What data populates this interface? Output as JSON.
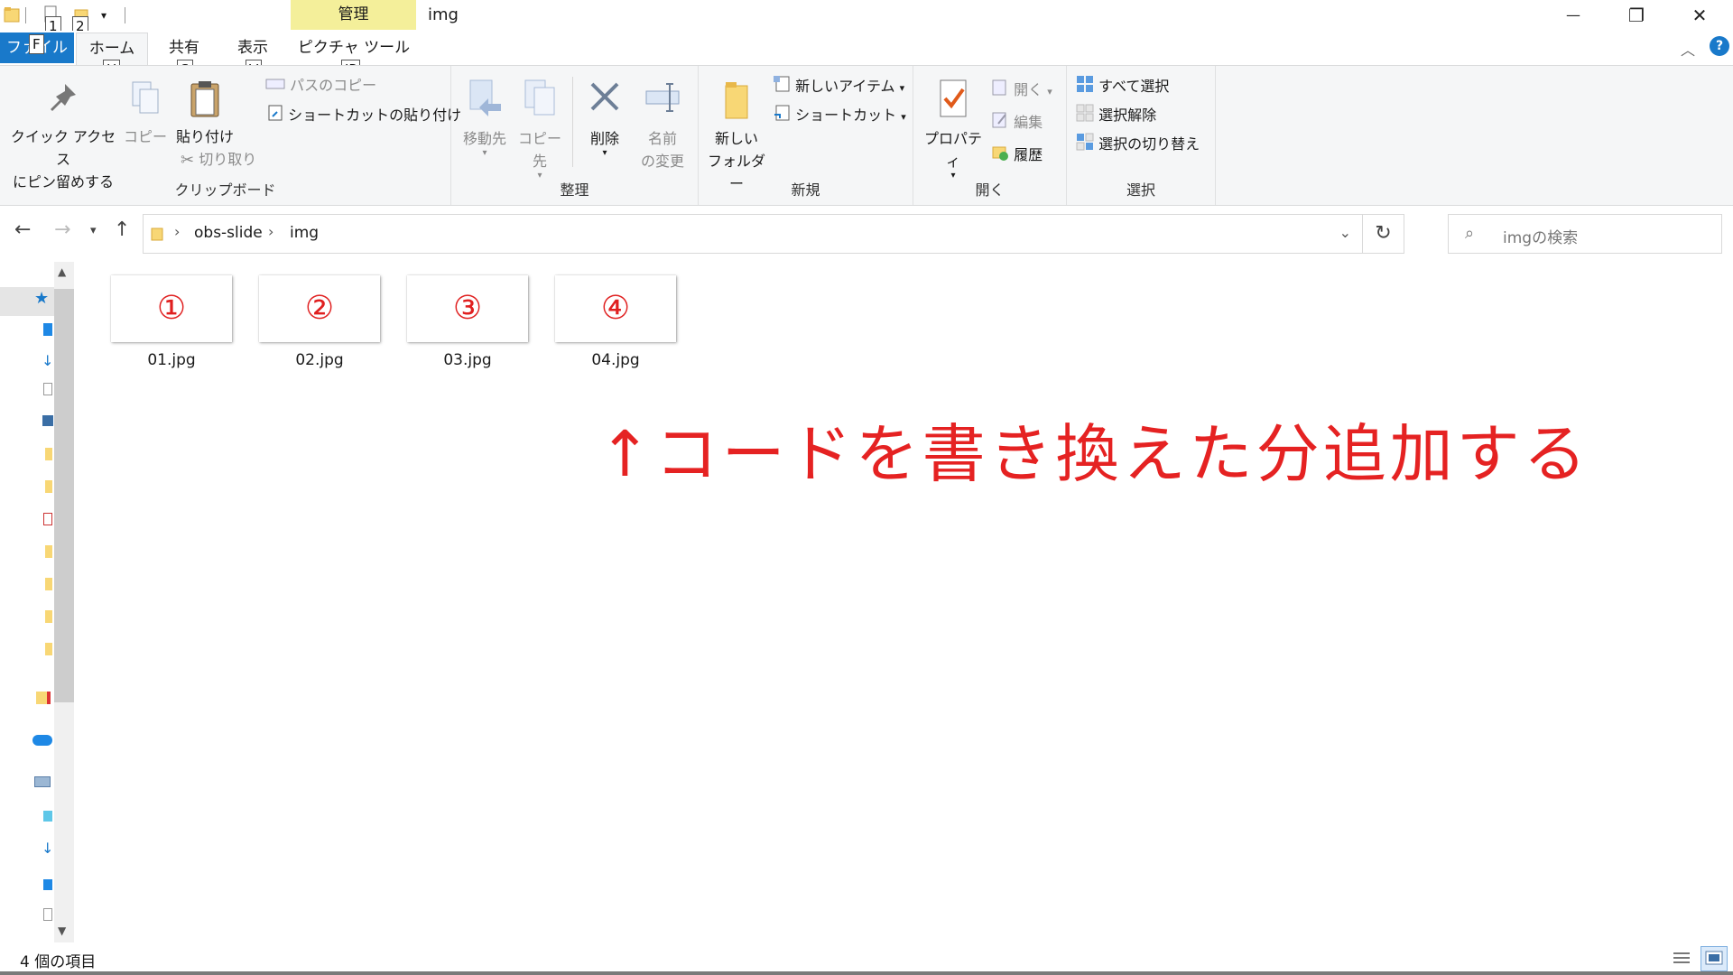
{
  "window": {
    "title": "img",
    "context_tab": "管理",
    "minimize": "—",
    "maximize": "❐",
    "close": "✕"
  },
  "keytips": {
    "qa1": "1",
    "qa2": "2",
    "file": "F",
    "home": "H",
    "share": "S",
    "view": "V",
    "picture": "JP"
  },
  "tabs": {
    "file": "ファイル",
    "home": "ホーム",
    "share": "共有",
    "view": "表示",
    "picture_tools": "ピクチャ ツール"
  },
  "ribbon": {
    "clipboard": {
      "label": "クリップボード",
      "pin_line1": "クイック アクセス",
      "pin_line2": "にピン留めする",
      "copy": "コピー",
      "paste": "貼り付け",
      "copy_path": "パスのコピー",
      "paste_shortcut": "ショートカットの貼り付け",
      "cut": "切り取り"
    },
    "organize": {
      "label": "整理",
      "move_to": "移動先",
      "copy_to": "コピー先",
      "delete": "削除",
      "rename_line1": "名前",
      "rename_line2": "の変更"
    },
    "new": {
      "label": "新規",
      "new_folder_line1": "新しい",
      "new_folder_line2": "フォルダー",
      "new_item": "新しいアイテム",
      "shortcut": "ショートカット"
    },
    "open": {
      "label": "開く",
      "properties": "プロパティ",
      "open": "開く",
      "edit": "編集",
      "history": "履歴"
    },
    "select": {
      "label": "選択",
      "select_all": "すべて選択",
      "select_none": "選択解除",
      "invert": "選択の切り替え"
    }
  },
  "address": {
    "crumbs": [
      "obs-slide",
      "img"
    ],
    "search_placeholder": "imgの検索"
  },
  "files": [
    {
      "thumb_label": "①",
      "name": "01.jpg"
    },
    {
      "thumb_label": "②",
      "name": "02.jpg"
    },
    {
      "thumb_label": "③",
      "name": "03.jpg"
    },
    {
      "thumb_label": "④",
      "name": "04.jpg"
    }
  ],
  "annotation": "↑コードを書き換えた分追加する",
  "status": {
    "item_count": "4 個の項目"
  },
  "colors": {
    "accent": "#1979ca",
    "annotation": "#e52222",
    "context_tab": "#f4ef9a"
  }
}
